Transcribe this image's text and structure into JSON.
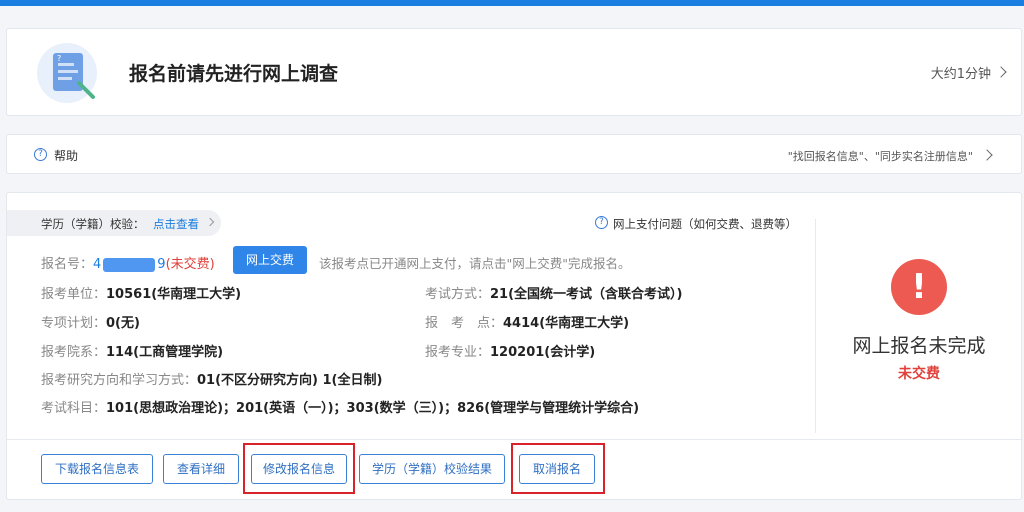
{
  "survey": {
    "title": "报名前请先进行网上调查",
    "time": "大约1分钟",
    "icon": "document-survey-icon"
  },
  "help": {
    "label": "帮助",
    "links": "\"找回报名信息\"、\"同步实名注册信息\""
  },
  "verification": {
    "label": "学历（学籍）校验：",
    "link": "点击查看",
    "payment_question": "网上支付问题（如何交费、退费等）"
  },
  "registration": {
    "number_label": "报名号：",
    "number_start": "4",
    "number_end": "9",
    "unpaid_inline": "(未交费)",
    "pay_button": "网上交费",
    "pay_note": "该报考点已开通网上支付，请点击\"网上交费\"完成报名。"
  },
  "fields": {
    "unit_label": "报考单位：",
    "unit_value": "10561(华南理工大学)",
    "exam_method_label": "考试方式：",
    "exam_method_value": "21(全国统一考试（含联合考试）)",
    "special_plan_label": "专项计划：",
    "special_plan_value": "0(无)",
    "exam_site_label": "报　考　点：",
    "exam_site_value": "4414(华南理工大学)",
    "department_label": "报考院系：",
    "department_value": "114(工商管理学院)",
    "major_label": "报考专业：",
    "major_value": "120201(会计学)",
    "direction_label": "报考研究方向和学习方式：",
    "direction_value": "01(不区分研究方向) 1(全日制)",
    "subjects_label": "考试科目：",
    "subjects_value": "101(思想政治理论)；201(英语（一）)；303(数学（三）)；826(管理学与管理统计学综合)"
  },
  "status": {
    "icon": "alert-exclamation-icon",
    "title": "网上报名未完成",
    "subtitle": "未交费",
    "color": "#ec5a52"
  },
  "actions": {
    "download": "下载报名信息表",
    "details": "查看详细",
    "modify": "修改报名信息",
    "verify_result": "学历（学籍）校验结果",
    "cancel": "取消报名"
  },
  "colors": {
    "accent": "#1a7de0",
    "highlight_box": "#d8232a",
    "warning": "#e0413a"
  }
}
